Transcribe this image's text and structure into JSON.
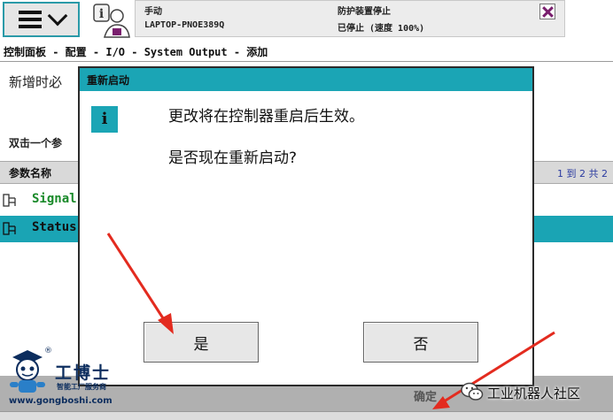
{
  "topbar": {
    "menu_icon": "hamburger-menu-icon",
    "robot_icon": "robot-info-icon",
    "status": {
      "mode": "手动",
      "controller": "LAPTOP-PNOE389Q",
      "safety_state": "防护装置停止",
      "motion_state": "已停止 (速度 100%)"
    },
    "close_icon": "close-icon"
  },
  "breadcrumb": "控制面板 - 配置 - I/O - System Output - 添加",
  "page": {
    "heading": "新增时必",
    "instruction": "双击一个参",
    "table": {
      "column_header": "参数名称",
      "pager": "1 到 2 共 2",
      "rows": [
        {
          "label": "Signal",
          "icon": "parameter-icon"
        },
        {
          "label": "Status",
          "icon": "parameter-icon"
        }
      ]
    },
    "bottom_text": "确定"
  },
  "dialog": {
    "title": "重新启动",
    "icon": "info-icon",
    "icon_glyph": "i",
    "message_line1": "更改将在控制器重启后生效。",
    "message_line2": "是否现在重新启动?",
    "yes_label": "是",
    "no_label": "否"
  },
  "watermark": {
    "brand": "工博士",
    "registered": "®",
    "tagline": "智能工厂服务商",
    "url": "www.gongboshi.com",
    "wechat_account": "工业机器人社区"
  },
  "colors": {
    "accent_teal": "#1ba5b5",
    "selected_row": "#1aa4b4",
    "signal_text": "#1a8a2a",
    "annotation_arrow": "#e32b1f"
  }
}
